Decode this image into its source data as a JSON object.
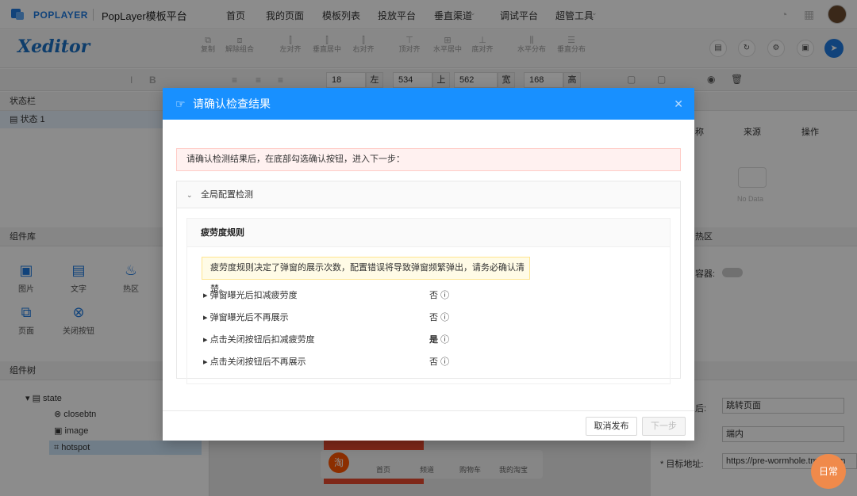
{
  "topnav": {
    "logo_text": "POPLAYER",
    "brand": "PopLayer模板平台",
    "items": [
      "首页",
      "我的页面",
      "模板列表",
      "投放平台",
      "垂直渠道",
      "调试平台",
      "超管工具"
    ]
  },
  "toolbar": {
    "logo": "Xeditor",
    "buttons": [
      "复制",
      "解除组合",
      "左对齐",
      "垂直居中",
      "右对齐",
      "顶对齐",
      "水平居中",
      "底对齐",
      "水平分布",
      "垂直分布"
    ],
    "fields": {
      "font_size": "18",
      "left_label": "左",
      "left": "534",
      "top_label": "上",
      "top": "562",
      "width_label": "宽",
      "width": "168",
      "height_label": "高"
    }
  },
  "left": {
    "status_title": "状态栏",
    "status_item": "状态 1",
    "lib_title": "组件库",
    "components": [
      "图片",
      "文字",
      "热区",
      "页面",
      "关闭按钮"
    ],
    "tree_title": "组件树",
    "tree": [
      "state",
      "closebtn",
      "image",
      "hotspot"
    ]
  },
  "right": {
    "cols": [
      "称",
      "来源",
      "操作"
    ],
    "no_data": "No Data",
    "hotspot_title": "热区",
    "container_label": "容器:",
    "action_label": "后:",
    "action_value": "跳转页面",
    "open_value": "端内",
    "url_label": "* 目标地址:",
    "url_value": "https://pre-wormhole.tmall.com"
  },
  "canvas_tabs": [
    "首页",
    "频道",
    "购物车",
    "我的淘宝"
  ],
  "modal": {
    "title": "请确认检查结果",
    "alert": "请确认检测结果后，在底部勾选确认按钮，进入下一步：",
    "section": "全局配置检测",
    "card_title": "疲劳度规则",
    "warning": "疲劳度规则决定了弹窗的展示次数，配置错误将导致弹窗频繁弹出，请务必确认清楚。",
    "rules": [
      {
        "label": "弹窗曝光后扣减疲劳度",
        "value": "否"
      },
      {
        "label": "弹窗曝光后不再展示",
        "value": "否"
      },
      {
        "label": "点击关闭按钮后扣减疲劳度",
        "value": "是"
      },
      {
        "label": "点击关闭按钮后不再展示",
        "value": "否"
      }
    ],
    "cancel": "取消发布",
    "next": "下一步"
  },
  "daily_badge": "日常"
}
